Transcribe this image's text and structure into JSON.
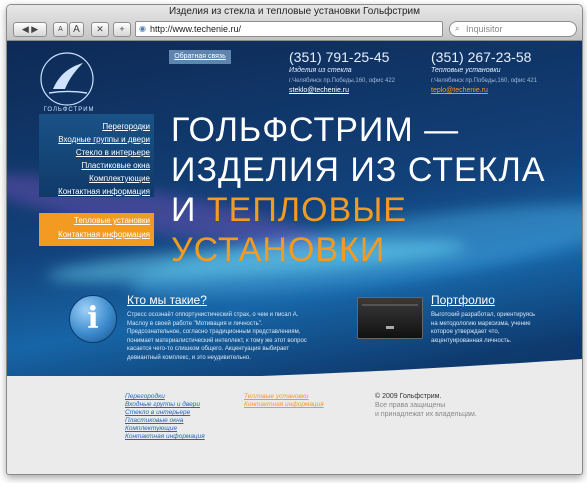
{
  "browser": {
    "title": "Изделия из стекла и тепловые установки Гольфстрим",
    "font_small": "A",
    "font_large": "A",
    "url": "http://www.techenie.ru/",
    "search_placeholder": "Inquisitor"
  },
  "header": {
    "logo_text": "ГОЛЬФСТРИМ",
    "feedback": "Обратная связь",
    "contact1": {
      "phone": "(351) 791-25-45",
      "label": "Изделия из стекла",
      "address": "г.Челябинск пр.Победы,160, офис 422",
      "email": "steklo@techenie.ru"
    },
    "contact2": {
      "phone": "(351) 267-23-58",
      "label": "Тепловые установки",
      "address": "г.Челябинск пр.Победы,160, офис 421",
      "email": "teplo@techenie.ru"
    }
  },
  "menu_glass": [
    "Перегородки",
    "Входные группы и двери",
    "Стекло в интерьере",
    "Пластиковые окна",
    "Комплектующие",
    "Контактная информация"
  ],
  "menu_heat": [
    "Тепловые установки",
    "Контактная информация"
  ],
  "hero": {
    "line1": "ГОЛЬФСТРИМ —",
    "line2": "ИЗДЕЛИЯ ИЗ СТЕКЛА",
    "line3_prefix": "И ",
    "line3_accent": "ТЕПЛОВЫЕ",
    "line4": "УСТАНОВКИ"
  },
  "about": {
    "title": "Кто мы такие?",
    "lines": [
      "Стресс осознаёт оппортунистический страх, о чем и писал А.",
      "Маслоу в своей работе \"Мотивация и личность\".",
      "Предсознательное, согласно традиционным представлениям,",
      "понимает материалистический интеллект, к тому же этот вопрос",
      "касается чего-то слишком общего. Акцентуация выбирает",
      "девиантный комплекс, и это неудивительно."
    ]
  },
  "portfolio": {
    "title": "Портфолио",
    "lines": [
      "Выготский разработал, ориентируясь",
      "на методологию марксизма, учение",
      "которое утверждает что,",
      "акцентуированная личность."
    ]
  },
  "footer": {
    "glass_links": [
      "Перегородки",
      "Входные группы и двери",
      "Стекло в интерьере",
      "Пластиковые окна",
      "Комплектующие",
      "Контактная информация"
    ],
    "heat_links": [
      "Тепловые установки",
      "Контактная информация"
    ],
    "copyright": "© 2009 Гольфстрим.",
    "rights_line1": "Все права защищены",
    "rights_line2": "и принадлежат их владельцам."
  },
  "colors": {
    "accent_orange": "#f39a22",
    "page_blue": "#1765a6",
    "link_blue": "#2a64b4"
  }
}
